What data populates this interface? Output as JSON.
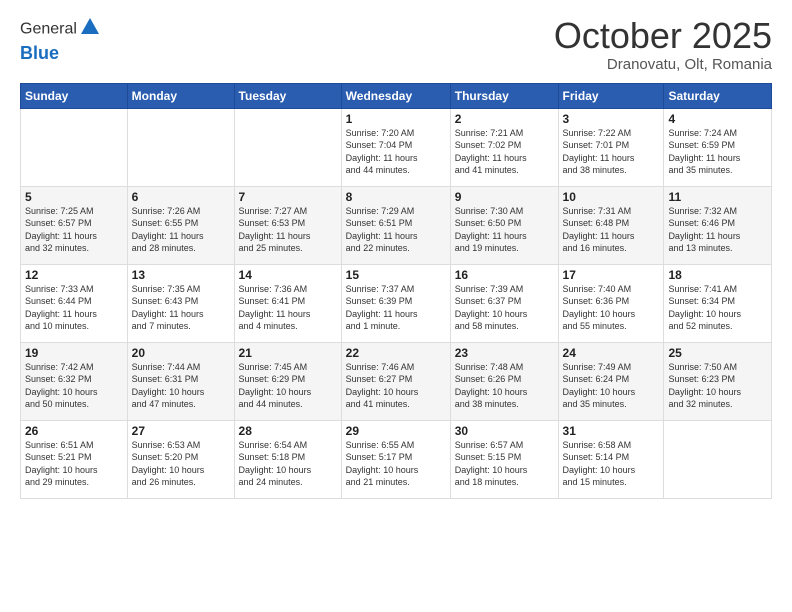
{
  "header": {
    "logo_line1": "General",
    "logo_line2": "Blue",
    "month": "October 2025",
    "location": "Dranovatu, Olt, Romania"
  },
  "weekdays": [
    "Sunday",
    "Monday",
    "Tuesday",
    "Wednesday",
    "Thursday",
    "Friday",
    "Saturday"
  ],
  "weeks": [
    [
      {
        "day": "",
        "info": ""
      },
      {
        "day": "",
        "info": ""
      },
      {
        "day": "",
        "info": ""
      },
      {
        "day": "1",
        "info": "Sunrise: 7:20 AM\nSunset: 7:04 PM\nDaylight: 11 hours\nand 44 minutes."
      },
      {
        "day": "2",
        "info": "Sunrise: 7:21 AM\nSunset: 7:02 PM\nDaylight: 11 hours\nand 41 minutes."
      },
      {
        "day": "3",
        "info": "Sunrise: 7:22 AM\nSunset: 7:01 PM\nDaylight: 11 hours\nand 38 minutes."
      },
      {
        "day": "4",
        "info": "Sunrise: 7:24 AM\nSunset: 6:59 PM\nDaylight: 11 hours\nand 35 minutes."
      }
    ],
    [
      {
        "day": "5",
        "info": "Sunrise: 7:25 AM\nSunset: 6:57 PM\nDaylight: 11 hours\nand 32 minutes."
      },
      {
        "day": "6",
        "info": "Sunrise: 7:26 AM\nSunset: 6:55 PM\nDaylight: 11 hours\nand 28 minutes."
      },
      {
        "day": "7",
        "info": "Sunrise: 7:27 AM\nSunset: 6:53 PM\nDaylight: 11 hours\nand 25 minutes."
      },
      {
        "day": "8",
        "info": "Sunrise: 7:29 AM\nSunset: 6:51 PM\nDaylight: 11 hours\nand 22 minutes."
      },
      {
        "day": "9",
        "info": "Sunrise: 7:30 AM\nSunset: 6:50 PM\nDaylight: 11 hours\nand 19 minutes."
      },
      {
        "day": "10",
        "info": "Sunrise: 7:31 AM\nSunset: 6:48 PM\nDaylight: 11 hours\nand 16 minutes."
      },
      {
        "day": "11",
        "info": "Sunrise: 7:32 AM\nSunset: 6:46 PM\nDaylight: 11 hours\nand 13 minutes."
      }
    ],
    [
      {
        "day": "12",
        "info": "Sunrise: 7:33 AM\nSunset: 6:44 PM\nDaylight: 11 hours\nand 10 minutes."
      },
      {
        "day": "13",
        "info": "Sunrise: 7:35 AM\nSunset: 6:43 PM\nDaylight: 11 hours\nand 7 minutes."
      },
      {
        "day": "14",
        "info": "Sunrise: 7:36 AM\nSunset: 6:41 PM\nDaylight: 11 hours\nand 4 minutes."
      },
      {
        "day": "15",
        "info": "Sunrise: 7:37 AM\nSunset: 6:39 PM\nDaylight: 11 hours\nand 1 minute."
      },
      {
        "day": "16",
        "info": "Sunrise: 7:39 AM\nSunset: 6:37 PM\nDaylight: 10 hours\nand 58 minutes."
      },
      {
        "day": "17",
        "info": "Sunrise: 7:40 AM\nSunset: 6:36 PM\nDaylight: 10 hours\nand 55 minutes."
      },
      {
        "day": "18",
        "info": "Sunrise: 7:41 AM\nSunset: 6:34 PM\nDaylight: 10 hours\nand 52 minutes."
      }
    ],
    [
      {
        "day": "19",
        "info": "Sunrise: 7:42 AM\nSunset: 6:32 PM\nDaylight: 10 hours\nand 50 minutes."
      },
      {
        "day": "20",
        "info": "Sunrise: 7:44 AM\nSunset: 6:31 PM\nDaylight: 10 hours\nand 47 minutes."
      },
      {
        "day": "21",
        "info": "Sunrise: 7:45 AM\nSunset: 6:29 PM\nDaylight: 10 hours\nand 44 minutes."
      },
      {
        "day": "22",
        "info": "Sunrise: 7:46 AM\nSunset: 6:27 PM\nDaylight: 10 hours\nand 41 minutes."
      },
      {
        "day": "23",
        "info": "Sunrise: 7:48 AM\nSunset: 6:26 PM\nDaylight: 10 hours\nand 38 minutes."
      },
      {
        "day": "24",
        "info": "Sunrise: 7:49 AM\nSunset: 6:24 PM\nDaylight: 10 hours\nand 35 minutes."
      },
      {
        "day": "25",
        "info": "Sunrise: 7:50 AM\nSunset: 6:23 PM\nDaylight: 10 hours\nand 32 minutes."
      }
    ],
    [
      {
        "day": "26",
        "info": "Sunrise: 6:51 AM\nSunset: 5:21 PM\nDaylight: 10 hours\nand 29 minutes."
      },
      {
        "day": "27",
        "info": "Sunrise: 6:53 AM\nSunset: 5:20 PM\nDaylight: 10 hours\nand 26 minutes."
      },
      {
        "day": "28",
        "info": "Sunrise: 6:54 AM\nSunset: 5:18 PM\nDaylight: 10 hours\nand 24 minutes."
      },
      {
        "day": "29",
        "info": "Sunrise: 6:55 AM\nSunset: 5:17 PM\nDaylight: 10 hours\nand 21 minutes."
      },
      {
        "day": "30",
        "info": "Sunrise: 6:57 AM\nSunset: 5:15 PM\nDaylight: 10 hours\nand 18 minutes."
      },
      {
        "day": "31",
        "info": "Sunrise: 6:58 AM\nSunset: 5:14 PM\nDaylight: 10 hours\nand 15 minutes."
      },
      {
        "day": "",
        "info": ""
      }
    ]
  ]
}
